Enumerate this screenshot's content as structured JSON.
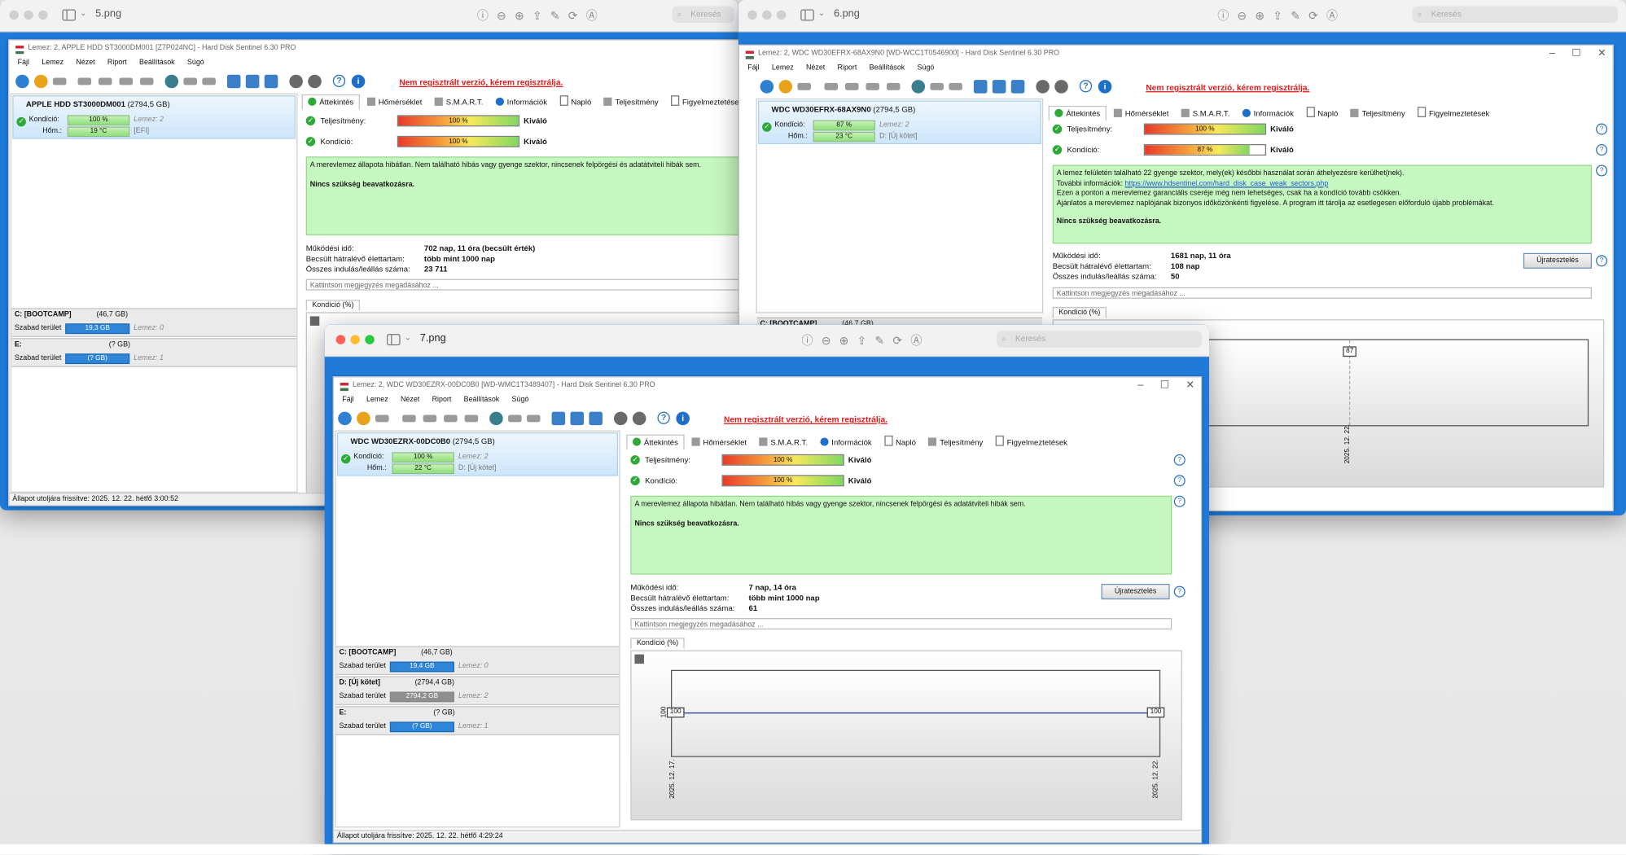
{
  "viewers": [
    {
      "title": "5.png",
      "search": "Keresés"
    },
    {
      "title": "6.png",
      "search": "Keresés"
    },
    {
      "title": "7.png",
      "search": "Keresés"
    }
  ],
  "menu": [
    "Fájl",
    "Lemez",
    "Nézet",
    "Riport",
    "Beállítások",
    "Súgó"
  ],
  "reg_notice": "Nem regisztrált verzió, kérem regisztrálja.",
  "tabs": [
    "Áttekintés",
    "Hőmérséklet",
    "S.M.A.R.T.",
    "Információk",
    "Napló",
    "Teljesítmény",
    "Figyelmeztetések"
  ],
  "labels": {
    "kondicio": "Kondíció:",
    "hom": "Hőm.:",
    "teljesitmeny": "Teljesítmény:",
    "kivalo": "Kiváló",
    "op_time": "Működési idő:",
    "life": "Becsült hátralévő élettartam:",
    "starts": "Összes indulás/leállás száma:",
    "note": "Kattintson megjegyzés megadásához ...",
    "chart_tab": "Kondíció",
    "chart_unit": "(%)",
    "free": "Szabad terület",
    "reset": "Újratesztelés",
    "no_action": "Nincs szükség beavatkozásra."
  },
  "win5": {
    "title": "Lemez: 2, APPLE HDD ST3000DM001 [Z7P024NC] - Hard Disk Sentinel 6.30 PRO",
    "drive": "APPLE HDD ST3000DM001",
    "size": "(2794,5 GB)",
    "kond": "100 %",
    "disk": "Lemez: 2",
    "temp": "19 °C",
    "part": "[EFI]",
    "perf": "100 %",
    "cond": "100 %",
    "msg": "A merevlemez állapota hibátlan. Nem található hibás vagy gyenge szektor, nincsenek felpörgési és adatátviteli hibák sem.",
    "op_time": "702 nap, 11 óra (becsült érték)",
    "life": "több mint 1000 nap",
    "starts": "23 711",
    "parts": [
      {
        "name": "C: [BOOTCAMP]",
        "size": "(46,7 GB)",
        "free": "19,3 GB",
        "disk": "Lemez: 0"
      },
      {
        "name": "E:",
        "size": "(? GB)",
        "free": "(? GB)",
        "disk": "Lemez: 1"
      }
    ],
    "status": "Állapot utoljára frissítve: 2025. 12. 22. hétfő 3:00:52"
  },
  "win6": {
    "title": "Lemez: 2, WDC WD30EFRX-68AX9N0 [WD-WCC1T0546900] - Hard Disk Sentinel 6.30 PRO",
    "drive": "WDC WD30EFRX-68AX9N0",
    "size": "(2794,5 GB)",
    "kond": "87 %",
    "disk": "Lemez: 2",
    "temp": "23 °C",
    "part": "D: [Új kötet]",
    "perf": "100 %",
    "cond": "87 %",
    "msg": [
      "A lemez felületén található 22 gyenge szektor, mely(ek) későbbi használat során áthelyezésre kerülhet(nek).",
      "További információk:",
      "https://www.hdsentinel.com/hard_disk_case_weak_sectors.php",
      "Ezen a ponton a merevlemez garanciális cseréje még nem lehetséges, csak ha a kondíció tovább csökken.",
      "Ajánlatos a merevlemez naplójának bizonyos időközönkénti figyelése. A program itt tárolja az esetlegesen előforduló újabb problémákat."
    ],
    "op_time": "1681 nap, 11 óra",
    "life": "108 nap",
    "starts": "50",
    "parts": [
      {
        "name": "C: [BOOTCAMP]",
        "size": "(46,7 GB)"
      }
    ],
    "chart": {
      "point_label": "87",
      "date": "2025. 12. 22."
    }
  },
  "win7": {
    "title": "Lemez: 2, WDC WD30EZRX-00DC0B0 [WD-WMC1T3489407] - Hard Disk Sentinel 6.30 PRO",
    "drive": "WDC WD30EZRX-00DC0B0",
    "size": "(2794,5 GB)",
    "kond": "100 %",
    "disk": "Lemez: 2",
    "temp": "22 °C",
    "part": "D: [Új kötet]",
    "perf": "100 %",
    "cond": "100 %",
    "msg": "A merevlemez állapota hibátlan. Nem található hibás vagy gyenge szektor, nincsenek felpörgési és adatátviteli hibák sem.",
    "op_time": "7 nap, 14 óra",
    "life": "több mint 1000 nap",
    "starts": "61",
    "parts": [
      {
        "name": "C: [BOOTCAMP]",
        "size": "(46,7 GB)",
        "free": "19,4 GB",
        "disk": "Lemez: 0"
      },
      {
        "name": "D: [Új kötet]",
        "size": "(2794,4 GB)",
        "free": "2794,2 GB",
        "disk": "Lemez: 2"
      },
      {
        "name": "E:",
        "size": "(? GB)",
        "free": "(? GB)",
        "disk": "Lemez: 1"
      }
    ],
    "chart": {
      "left_label": "100",
      "right_label": "100",
      "ytick": "100",
      "date_start": "2025. 12. 17.",
      "date_end": "2025. 12. 22."
    },
    "status": "Állapot utoljára frissítve: 2025. 12. 22. hétfő 4:29:24"
  },
  "chart_data": [
    {
      "type": "line",
      "title": "",
      "x": [
        "2025. 12. 17.",
        "2025. 12. 22."
      ],
      "series": [
        {
          "values": [
            100,
            100
          ]
        }
      ],
      "data_labels": [
        "100",
        "100"
      ],
      "ylabel": "",
      "xlabel": ""
    },
    {
      "type": "line",
      "title": "",
      "x": [
        "2025. 12. 22."
      ],
      "series": [
        {
          "values": [
            87
          ]
        }
      ],
      "data_labels": [
        "87"
      ],
      "ylabel": "",
      "xlabel": ""
    }
  ]
}
